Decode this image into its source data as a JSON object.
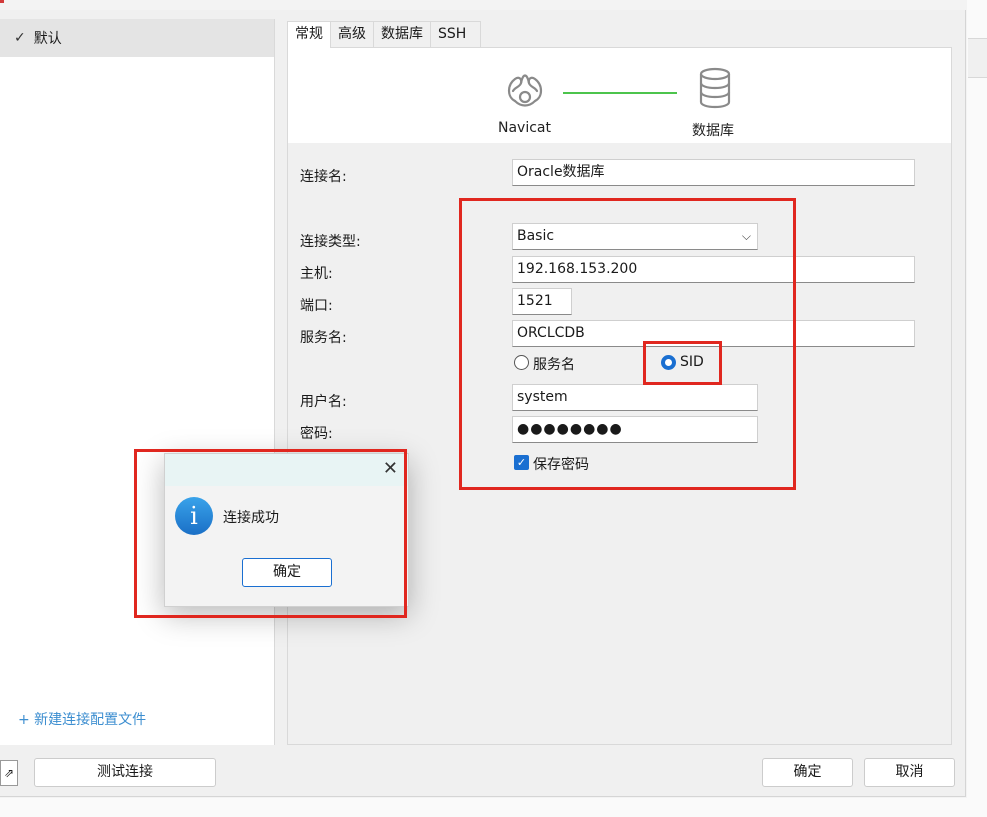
{
  "left_panel": {
    "selected_profile": "默认",
    "new_profile_link": "+ 新建连接配置文件"
  },
  "tabs": [
    "常规",
    "高级",
    "数据库",
    "SSH"
  ],
  "banner": {
    "navicat_label": "Navicat",
    "database_label": "数据库"
  },
  "form": {
    "connection_name_label": "连接名:",
    "connection_name_value": "Oracle数据库",
    "connection_type_label": "连接类型:",
    "connection_type_value": "Basic",
    "host_label": "主机:",
    "host_value": "192.168.153.200",
    "port_label": "端口:",
    "port_value": "1521",
    "service_name_label": "服务名:",
    "service_name_value": "ORCLCDB",
    "radio_service_name": "服务名",
    "radio_sid": "SID",
    "selected_radio": "SID",
    "username_label": "用户名:",
    "username_value": "system",
    "password_label": "密码:",
    "password_value": "●●●●●●●●",
    "save_password_label": "保存密码",
    "save_password_checked": true
  },
  "dialog": {
    "message": "连接成功",
    "ok_button": "确定",
    "close_glyph": "✕",
    "info_glyph": "i"
  },
  "footer": {
    "test_connection_button": "测试连接",
    "ok_button": "确定",
    "cancel_button": "取消"
  },
  "colors": {
    "accent": "#1a6fd1",
    "highlight_box": "#e0271f",
    "connector_line": "#4cc44c",
    "link": "#3c8ed0"
  }
}
